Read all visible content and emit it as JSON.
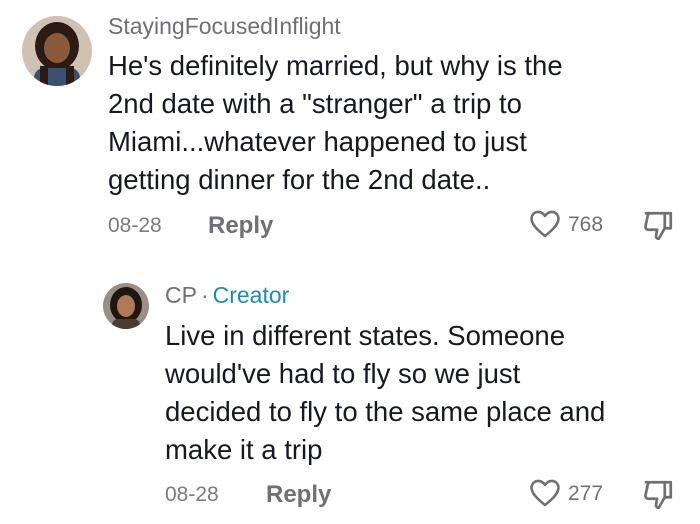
{
  "comments": [
    {
      "username": "StayingFocusedInflight",
      "lines": [
        "He's definitely married, but why is the",
        "2nd date with a \"stranger\" a trip to",
        "Miami...whatever happened to just",
        "getting dinner for the 2nd date.."
      ],
      "date": "08-28",
      "reply_label": "Reply",
      "likes": "768"
    },
    {
      "username": "CP",
      "separator": "·",
      "creator_label": "Creator",
      "lines": [
        "Live in different states. Someone",
        "would've had to fly so we just",
        "decided to fly to the same place and",
        "make it a trip"
      ],
      "date": "08-28",
      "reply_label": "Reply",
      "likes": "277"
    }
  ],
  "colors": {
    "text": "#161823",
    "muted": "#6f7076",
    "creator": "#1e8bb0"
  },
  "icons": {
    "like": "heart-outline-icon",
    "dislike": "thumbs-down-outline-icon"
  }
}
